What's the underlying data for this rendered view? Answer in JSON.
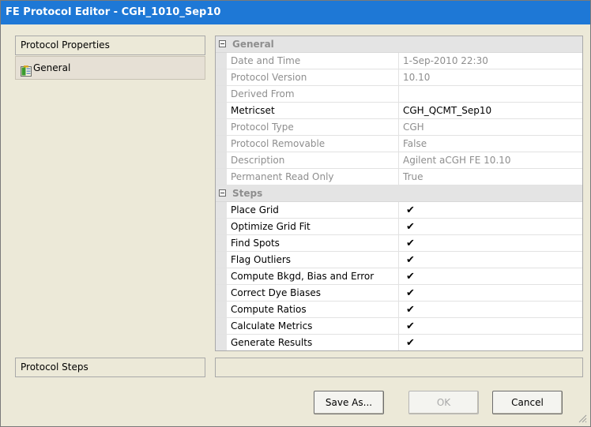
{
  "window": {
    "title": "FE Protocol Editor - CGH_1010_Sep10"
  },
  "left": {
    "properties_header": "Protocol Properties",
    "nav_items": [
      {
        "label": "General",
        "icon": "properties-icon"
      }
    ],
    "steps_header": "Protocol Steps"
  },
  "grid": {
    "general": {
      "title": "General",
      "rows": [
        {
          "name": "Date and Time",
          "value": "1-Sep-2010 22:30"
        },
        {
          "name": "Protocol Version",
          "value": "10.10"
        },
        {
          "name": "Derived From",
          "value": ""
        },
        {
          "name": "Metricset",
          "value": "CGH_QCMT_Sep10"
        },
        {
          "name": "Protocol Type",
          "value": "CGH"
        },
        {
          "name": "Protocol Removable",
          "value": "False"
        },
        {
          "name": "Description",
          "value": "Agilent aCGH FE 10.10"
        },
        {
          "name": "Permanent Read Only",
          "value": "True"
        }
      ]
    },
    "steps": {
      "title": "Steps",
      "check_glyph": "✔",
      "rows": [
        {
          "name": "Place Grid",
          "checked": true
        },
        {
          "name": "Optimize Grid Fit",
          "checked": true
        },
        {
          "name": "Find Spots",
          "checked": true
        },
        {
          "name": "Flag Outliers",
          "checked": true
        },
        {
          "name": "Compute Bkgd, Bias and Error",
          "checked": true
        },
        {
          "name": "Correct Dye Biases",
          "checked": true
        },
        {
          "name": "Compute Ratios",
          "checked": true
        },
        {
          "name": "Calculate Metrics",
          "checked": true
        },
        {
          "name": "Generate Results",
          "checked": true
        }
      ]
    }
  },
  "buttons": {
    "save_as": "Save As...",
    "ok": "OK",
    "cancel": "Cancel"
  },
  "colors": {
    "titlebar": "#1e78d6",
    "disabled_text": "#8e8e8e",
    "panel_bg": "#ece9d8"
  }
}
